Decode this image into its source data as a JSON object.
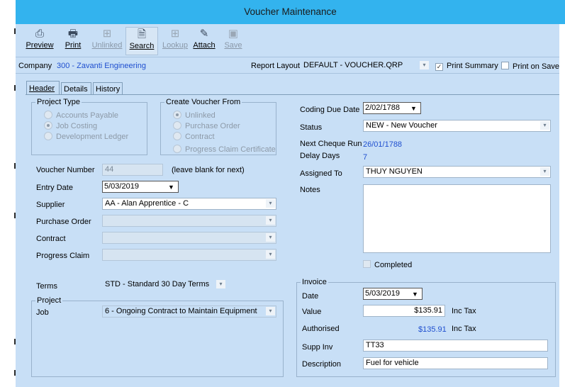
{
  "window": {
    "title": "Voucher Maintenance"
  },
  "toolbar": {
    "buttons": [
      {
        "label": "Preview",
        "icon": "preview-icon",
        "glyph": "⎙",
        "enabled": true
      },
      {
        "label": "Print",
        "icon": "printer-icon",
        "glyph": "🖶",
        "enabled": true
      },
      {
        "label": "Unlinked",
        "icon": "binoculars-icon",
        "glyph": "⊞",
        "enabled": false
      },
      {
        "label": "Search",
        "icon": "search-icon",
        "glyph": "🗎",
        "enabled": true
      },
      {
        "label": "Lookup",
        "icon": "binoculars-icon",
        "glyph": "⊞",
        "enabled": false
      },
      {
        "label": "Attach",
        "icon": "paperclip-icon",
        "glyph": "✎",
        "enabled": true
      },
      {
        "label": "Save",
        "icon": "floppy-disk-icon",
        "glyph": "▣",
        "enabled": false
      }
    ]
  },
  "info_bar": {
    "company_label": "Company",
    "company_value": "300 - Zavanti Engineering",
    "report_layout_label": "Report Layout",
    "report_layout_value": "DEFAULT - VOUCHER.QRP",
    "print_summary_label": "Print Summary",
    "print_summary_checked": true,
    "print_on_save_label": "Print on Save",
    "print_on_save_checked": false
  },
  "tabs": [
    {
      "label": "Header",
      "active": true
    },
    {
      "label": "Details",
      "active": false
    },
    {
      "label": "History",
      "active": false
    }
  ],
  "project_type": {
    "title": "Project Type",
    "options": [
      "Accounts Payable",
      "Job Costing",
      "Development Ledger"
    ],
    "selected": "Job Costing"
  },
  "create_from": {
    "title": "Create Voucher From",
    "options": [
      "Unlinked",
      "Purchase Order",
      "Contract",
      "Progress Claim Certificate"
    ],
    "selected": "Unlinked"
  },
  "form": {
    "voucher_number_label": "Voucher Number",
    "voucher_number_value": "44",
    "voucher_number_hint": "(leave blank for next)",
    "entry_date_label": "Entry Date",
    "entry_date_value": "5/03/2019",
    "supplier_label": "Supplier",
    "supplier_value": "AA - Alan Apprentice - C",
    "purchase_order_label": "Purchase Order",
    "purchase_order_value": "",
    "contract_label": "Contract",
    "contract_value": "",
    "progress_claim_label": "Progress Claim",
    "progress_claim_value": "",
    "terms_label": "Terms",
    "terms_value": "STD - Standard 30 Day Terms",
    "project_group_title": "Project",
    "job_label": "Job",
    "job_value": "6 - Ongoing Contract to Maintain  Equipment"
  },
  "right": {
    "coding_due_date_label": "Coding Due Date",
    "coding_due_date_value": "2/02/1788",
    "status_label": "Status",
    "status_value": "NEW - New Voucher",
    "next_cheque_run_label": "Next Cheque Run",
    "next_cheque_run_value": "26/01/1788",
    "delay_days_label": "Delay Days",
    "delay_days_value": "7",
    "assigned_to_label": "Assigned To",
    "assigned_to_value": "THUY NGUYEN",
    "notes_label": "Notes",
    "notes_value": "",
    "completed_label": "Completed",
    "completed_checked": false
  },
  "invoice": {
    "group_title": "Invoice",
    "date_label": "Date",
    "date_value": "5/03/2019",
    "value_label": "Value",
    "value_value": "$135.91",
    "value_suffix": "Inc Tax",
    "authorised_label": "Authorised",
    "authorised_value": "$135.91",
    "authorised_suffix": "Inc Tax",
    "supp_inv_label": "Supp Inv",
    "supp_inv_value": "TT33",
    "description_label": "Description",
    "description_value": "Fuel for vehicle"
  },
  "colors": {
    "titlebar": "#33b3ee",
    "client": "#c8dff6",
    "link_blue": "#1f4fcf"
  }
}
